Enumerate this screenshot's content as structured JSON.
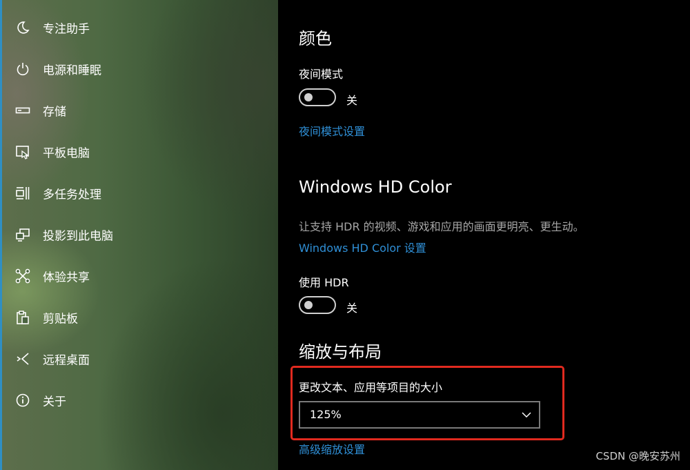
{
  "sidebar": {
    "items": [
      {
        "label": "专注助手",
        "icon": "moon-icon"
      },
      {
        "label": "电源和睡眠",
        "icon": "power-icon"
      },
      {
        "label": "存储",
        "icon": "storage-icon"
      },
      {
        "label": "平板电脑",
        "icon": "tablet-icon"
      },
      {
        "label": "多任务处理",
        "icon": "multitasking-icon"
      },
      {
        "label": "投影到此电脑",
        "icon": "project-icon"
      },
      {
        "label": "体验共享",
        "icon": "share-icon"
      },
      {
        "label": "剪贴板",
        "icon": "clipboard-icon"
      },
      {
        "label": "远程桌面",
        "icon": "remote-desktop-icon"
      },
      {
        "label": "关于",
        "icon": "info-icon"
      }
    ]
  },
  "main": {
    "color": {
      "title": "颜色",
      "night_light_label": "夜间模式",
      "night_light_state": "关",
      "night_light_settings_link": "夜间模式设置"
    },
    "hd_color": {
      "title": "Windows HD Color",
      "description": "让支持 HDR 的视频、游戏和应用的画面更明亮、更生动。",
      "settings_link": "Windows HD Color 设置",
      "use_hdr_label": "使用 HDR",
      "use_hdr_state": "关"
    },
    "scale_layout": {
      "title": "缩放与布局",
      "change_size_label": "更改文本、应用等项目的大小",
      "selected_scale": "125%",
      "advanced_link": "高级缩放设置"
    }
  },
  "watermark": "CSDN @晚安苏州",
  "colors": {
    "link": "#2f8fd6",
    "highlight_border": "#e12a1f",
    "toggle_off": "#d0d0d0"
  }
}
